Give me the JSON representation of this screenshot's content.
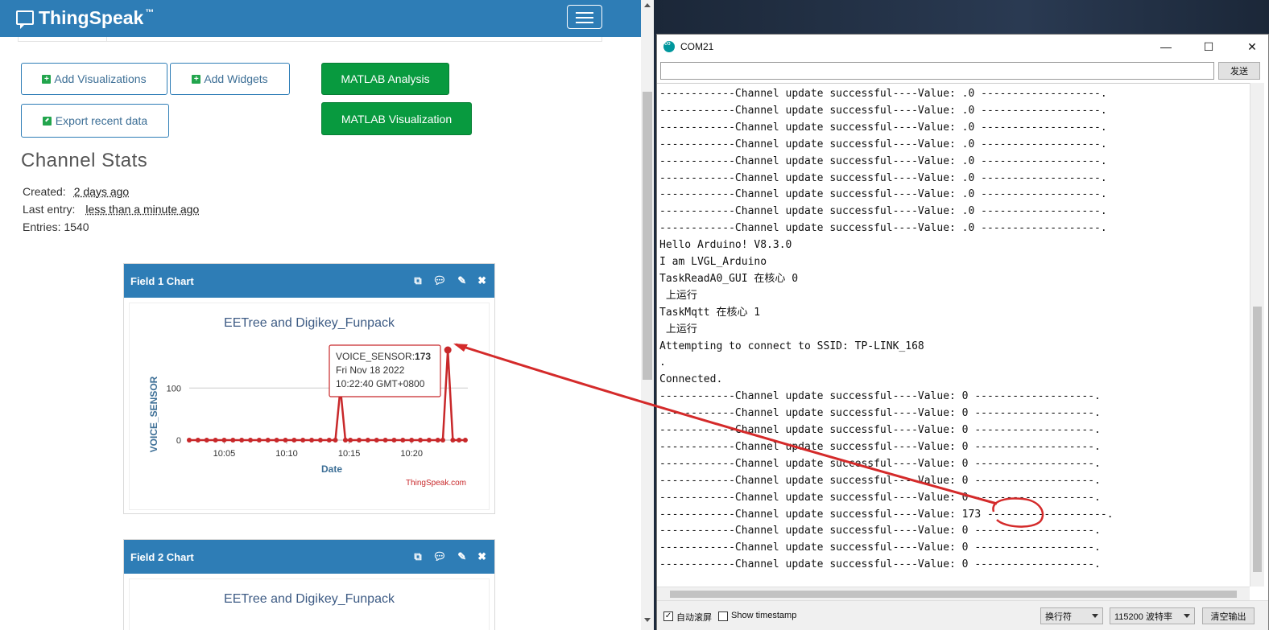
{
  "browser": {
    "brand": "ThingSpeak",
    "brand_tm": "™",
    "buttons": {
      "add_visualizations": "Add Visualizations",
      "add_widgets": "Add Widgets",
      "export_recent_data": "Export recent data",
      "matlab_analysis": "MATLAB Analysis",
      "matlab_visualization": "MATLAB Visualization"
    },
    "stats": {
      "title": "Channel Stats",
      "created_label": "Created:",
      "created_value": "2 days ago",
      "last_entry_label": "Last entry:",
      "last_entry_value": "less than a minute ago",
      "entries": "Entries: 1540"
    },
    "panels": [
      {
        "title": "Field 1 Chart",
        "chart_title": "EETree and Digikey_Funpack"
      },
      {
        "title": "Field 2 Chart",
        "chart_title": "EETree and Digikey_Funpack"
      }
    ],
    "tooltip": {
      "series": "VOICE_SENSOR:",
      "value": "173",
      "date": "Fri Nov 18 2022",
      "time": "10:22:40 GMT+0800"
    },
    "credit": "ThingSpeak.com"
  },
  "chart_data": {
    "type": "line",
    "title": "EETree and Digikey_Funpack",
    "xlabel": "Date",
    "ylabel": "VOICE_SENSOR",
    "x_ticks": [
      "10:05",
      "10:10",
      "10:15",
      "10:20"
    ],
    "x_tick_minutes": [
      5,
      10,
      15,
      20
    ],
    "y_ticks": [
      0,
      100
    ],
    "ylim": [
      0,
      173
    ],
    "xlim": [
      2.2,
      24.5
    ],
    "color": "#c8282a",
    "series": [
      {
        "x": [
          2.2,
          2.9,
          3.6,
          4.3,
          5.0,
          5.7,
          6.4,
          7.1,
          7.8,
          8.5,
          9.2,
          9.9,
          10.6,
          11.3,
          12.0,
          12.7,
          13.4,
          13.9,
          14.3,
          14.7,
          15.1,
          15.8,
          16.5,
          17.2,
          17.9,
          18.6,
          19.3,
          20.0,
          20.7,
          21.4,
          22.1,
          22.5,
          22.9,
          23.3,
          23.8,
          24.3
        ],
        "values": [
          0,
          0,
          0,
          0,
          0,
          0,
          0,
          0,
          0,
          0,
          0,
          0,
          0,
          0,
          0,
          0,
          0,
          0,
          100,
          0,
          0,
          0,
          0,
          0,
          0,
          0,
          0,
          0,
          0,
          0,
          0,
          0,
          173,
          0,
          0,
          0
        ]
      }
    ]
  },
  "serial": {
    "title": "COM21",
    "send_label": "发送",
    "lines": [
      "------------Channel update successful----Value: .0 -------------------.",
      "------------Channel update successful----Value: .0 -------------------.",
      "------------Channel update successful----Value: .0 -------------------.",
      "------------Channel update successful----Value: .0 -------------------.",
      "------------Channel update successful----Value: .0 -------------------.",
      "------------Channel update successful----Value: .0 -------------------.",
      "------------Channel update successful----Value: .0 -------------------.",
      "------------Channel update successful----Value: .0 -------------------.",
      "------------Channel update successful----Value: .0 -------------------.",
      "Hello Arduino! V8.3.0",
      "I am LVGL_Arduino",
      "TaskReadA0_GUI 在核心 0",
      " 上运行",
      "TaskMqtt 在核心 1",
      " 上运行",
      "Attempting to connect to SSID: TP-LINK_168",
      ".",
      "Connected.",
      "------------Channel update successful----Value: 0 -------------------.",
      "------------Channel update successful----Value: 0 -------------------.",
      "------------Channel update successful----Value: 0 -------------------.",
      "------------Channel update successful----Value: 0 -------------------.",
      "------------Channel update successful----Value: 0 -------------------.",
      "------------Channel update successful----Value: 0 -------------------.",
      "------------Channel update successful----Value: 0 -------------------.",
      "------------Channel update successful----Value: 173 -------------------.",
      "------------Channel update successful----Value: 0 -------------------.",
      "------------Channel update successful----Value: 0 -------------------.",
      "------------Channel update successful----Value: 0 -------------------."
    ],
    "autoscroll_label": "自动滚屏",
    "timestamp_label": "Show timestamp",
    "line_ending": "换行符",
    "baud": "115200 波特率",
    "clear_label": "清空输出"
  },
  "accent_color": "#2e7db6",
  "annotation_color": "#d42a2a"
}
